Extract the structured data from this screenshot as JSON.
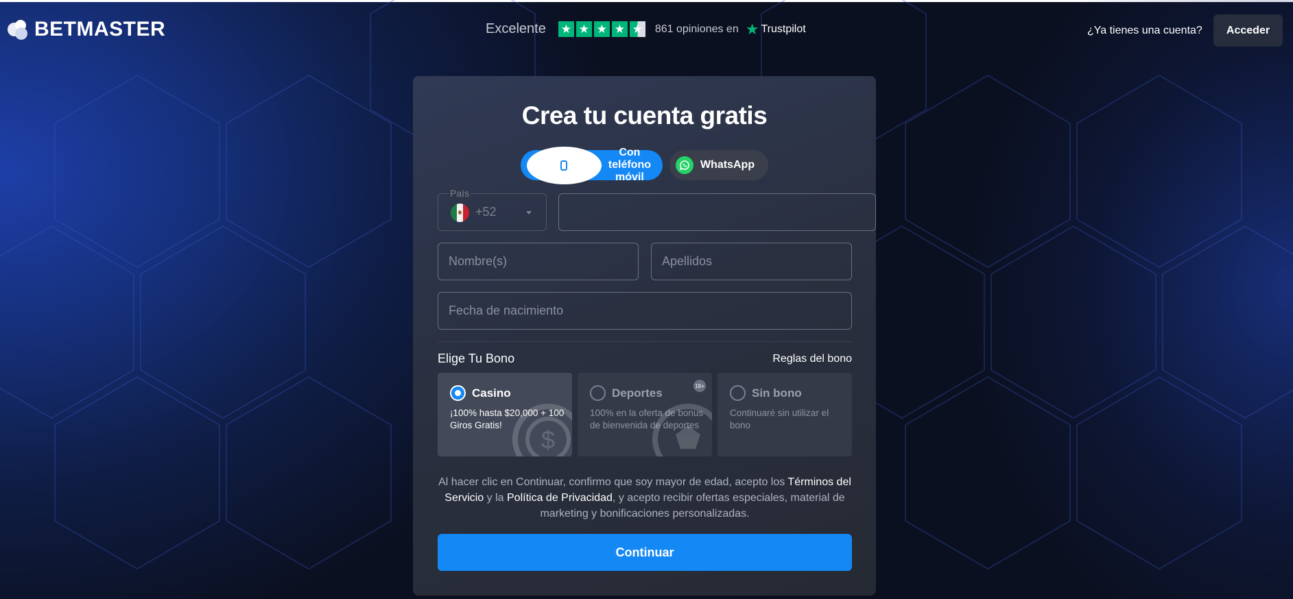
{
  "brand": {
    "name": "BETMASTER"
  },
  "trustpilot": {
    "rating_text": "Excelente",
    "stars": 4.5,
    "reviews": "861 opiniones en",
    "platform": "Trustpilot",
    "color": "#00b67a"
  },
  "header": {
    "account_question": "¿Ya tienes una cuenta?",
    "login_label": "Acceder"
  },
  "form": {
    "title": "Crea tu cuenta gratis",
    "methods": [
      {
        "label": "Con teléfono móvil",
        "icon": "phone-icon",
        "active": true
      },
      {
        "label": "WhatsApp",
        "icon": "whatsapp-icon",
        "active": false
      }
    ],
    "country_label": "País",
    "country_code": "+52",
    "phone_value": "",
    "first_name_placeholder": "Nombre(s)",
    "last_name_placeholder": "Apellidos",
    "birthdate_placeholder": "Fecha de nacimiento",
    "bonus_title": "Elige Tu Bono",
    "bonus_rules": "Reglas del bono",
    "bonuses": [
      {
        "name": "Casino",
        "desc": "¡100% hasta $20,000 + 100 Giros Gratis!",
        "selected": true
      },
      {
        "name": "Deportes",
        "desc": "100% en la oferta de bonus de bienvenida de deportes",
        "selected": false,
        "badge": "18+"
      },
      {
        "name": "Sin bono",
        "desc": "Continuaré sin utilizar el bono",
        "selected": false
      }
    ],
    "terms": {
      "part1": "Al hacer clic en Continuar, confirmo que soy mayor de edad, acepto los ",
      "tos_link": "Términos del Servicio",
      "part2": " y la ",
      "privacy_link": "Política de Privacidad",
      "part3": ", y acepto recibir ofertas especiales, material de marketing y bonificaciones personalizadas."
    },
    "submit_label": "Continuar"
  },
  "colors": {
    "accent": "#1488f5",
    "card": "#2a3040",
    "background": "#0b1020"
  }
}
